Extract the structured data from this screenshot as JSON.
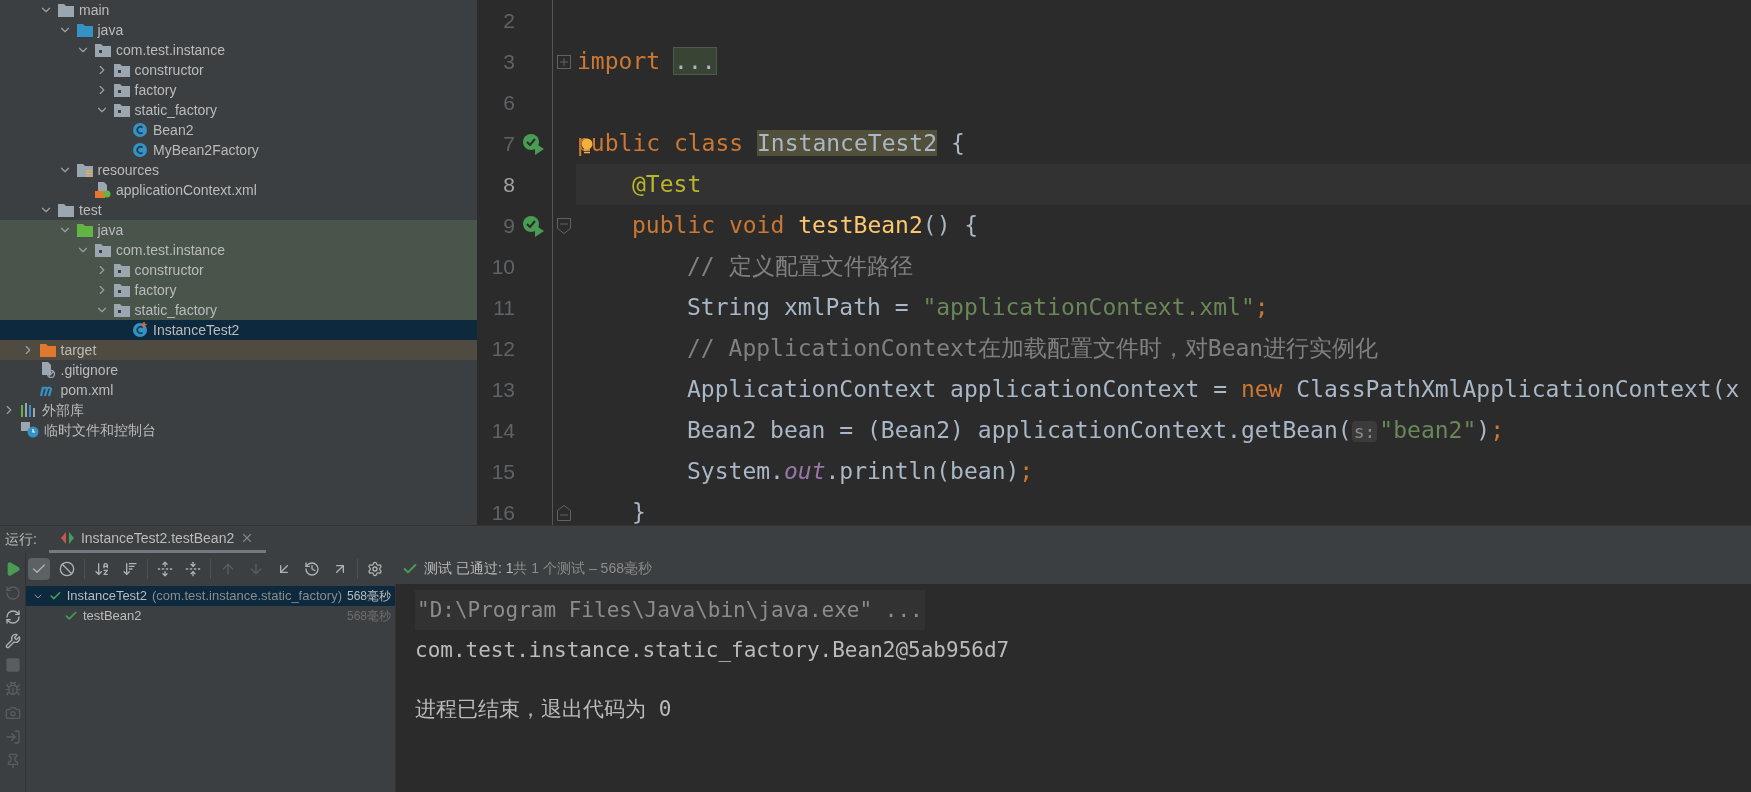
{
  "project_tree": [
    {
      "children": [
        {
          "children": [
            {
              "label": "main",
              "kind": "folder",
              "expanded": true,
              "selected": false,
              "children": [
                {
                  "label": "java",
                  "kind": "source-root",
                  "expanded": true,
                  "selected": false,
                  "children": [
                    {
                      "label": "com.test.instance",
                      "kind": "package",
                      "expanded": true,
                      "selected": false,
                      "children": [
                        {
                          "label": "constructor",
                          "kind": "package",
                          "expanded": false,
                          "selected": false
                        },
                        {
                          "label": "factory",
                          "kind": "package",
                          "expanded": false,
                          "selected": false
                        },
                        {
                          "label": "static_factory",
                          "kind": "package",
                          "expanded": true,
                          "selected": false,
                          "children": [
                            {
                              "label": "Bean2",
                              "kind": "class",
                              "selected": false
                            },
                            {
                              "label": "MyBean2Factory",
                              "kind": "class",
                              "selected": false
                            }
                          ]
                        }
                      ]
                    }
                  ]
                },
                {
                  "label": "resources",
                  "kind": "resources-root",
                  "expanded": true,
                  "selected": false,
                  "children": [
                    {
                      "label": "applicationContext.xml",
                      "kind": "xml",
                      "selected": false
                    }
                  ]
                }
              ]
            },
            {
              "label": "test",
              "kind": "folder",
              "expanded": true,
              "selected": false,
              "children": [
                {
                  "label": "java",
                  "kind": "test-root",
                  "expanded": true,
                  "selected": false,
                  "children": [
                    {
                      "label": "com.test.instance",
                      "kind": "package",
                      "expanded": true,
                      "selected": false,
                      "children": [
                        {
                          "label": "constructor",
                          "kind": "package",
                          "expanded": false,
                          "selected": false
                        },
                        {
                          "label": "factory",
                          "kind": "package",
                          "expanded": false,
                          "selected": false
                        },
                        {
                          "label": "static_factory",
                          "kind": "package",
                          "expanded": true,
                          "selected": false,
                          "children": [
                            {
                              "label": "InstanceTest2",
                              "kind": "test-class",
                              "selected": true
                            }
                          ]
                        }
                      ]
                    }
                  ]
                }
              ]
            }
          ]
        },
        {
          "label": "target",
          "kind": "excluded",
          "expanded": false,
          "selected": false
        },
        {
          "label": ".gitignore",
          "kind": "gitignore",
          "selected": false
        },
        {
          "label": "pom.xml",
          "kind": "maven",
          "selected": false
        }
      ]
    },
    {
      "label": "外部库",
      "kind": "libraries",
      "expanded": false,
      "selected": false
    },
    {
      "label": "临时文件和控制台",
      "kind": "scratches",
      "selected": false
    }
  ],
  "editor": {
    "lines": [
      {
        "number": "2",
        "current": false
      },
      {
        "number": "3",
        "kind": "top",
        "current": false,
        "fold_marker": {
          "kind": "expand"
        },
        "tokens": [
          {
            "kind": "keyword",
            "text": "import"
          },
          {
            "kind": "folded",
            "text": "..."
          }
        ]
      },
      {
        "number": "6",
        "current": false
      },
      {
        "number": "7",
        "kind": "top",
        "current": false,
        "run_marker": true,
        "bulb": true,
        "tokens": [
          {
            "kind": "keyword",
            "text": "public class "
          },
          {
            "kind": "highlight",
            "text": "InstanceTest2"
          },
          {
            "kind": "plain",
            "text": " {"
          }
        ]
      },
      {
        "number": "8",
        "kind": "member",
        "current": true,
        "tokens": [
          {
            "kind": "annotation",
            "text": "@Test"
          }
        ]
      },
      {
        "number": "9",
        "kind": "member",
        "current": false,
        "run_marker": true,
        "fold_marker": {
          "kind": "collapse"
        },
        "tokens": [
          {
            "kind": "keyword",
            "text": "public void "
          },
          {
            "kind": "method",
            "text": "testBean2"
          },
          {
            "kind": "plain",
            "text": "() {"
          }
        ]
      },
      {
        "number": "10",
        "kind": "body",
        "current": false,
        "tokens": [
          {
            "kind": "comment",
            "text": "// 定义配置文件路径"
          }
        ]
      },
      {
        "number": "11",
        "kind": "body",
        "current": false,
        "tokens": [
          {
            "kind": "plain",
            "text": "String xmlPath = "
          },
          {
            "kind": "string",
            "text": "\"applicationContext.xml\""
          },
          {
            "kind": "keyword",
            "text": ";"
          }
        ]
      },
      {
        "number": "12",
        "kind": "body",
        "current": false,
        "tokens": [
          {
            "kind": "comment",
            "text": "// ApplicationContext在加载配置文件时，对Bean进行实例化"
          }
        ]
      },
      {
        "number": "13",
        "kind": "body",
        "current": false,
        "tokens": [
          {
            "kind": "plain",
            "text": "ApplicationContext applicationContext = "
          },
          {
            "kind": "keyword",
            "text": "new"
          },
          {
            "kind": "plain",
            "text": " ClassPathXmlApplicationContext(x"
          }
        ]
      },
      {
        "number": "14",
        "kind": "body",
        "current": false,
        "tokens": [
          {
            "kind": "plain",
            "text": "Bean2 bean = (Bean2) applicationContext.getBean("
          },
          {
            "kind": "hint",
            "text": "s:"
          },
          {
            "kind": "string",
            "text": "\"bean2\""
          },
          {
            "kind": "plain",
            "text": ")"
          },
          {
            "kind": "keyword",
            "text": ";"
          }
        ]
      },
      {
        "number": "15",
        "kind": "body",
        "current": false,
        "tokens": [
          {
            "kind": "plain",
            "text": "System."
          },
          {
            "kind": "field",
            "text": "out"
          },
          {
            "kind": "plain",
            "text": ".println(bean)"
          },
          {
            "kind": "keyword",
            "text": ";"
          }
        ]
      },
      {
        "number": "16",
        "kind": "member",
        "current": false,
        "fold_marker": {
          "kind": "end"
        },
        "tokens": [
          {
            "kind": "plain",
            "text": "}"
          }
        ]
      }
    ]
  },
  "run_panel": {
    "label": "运行:",
    "tabs": [
      {
        "label": "InstanceTest2.testBean2",
        "selected": true
      }
    ],
    "side_toolbar": [
      {
        "kind": "run",
        "disabled": false
      },
      {
        "kind": "rerun-failed",
        "disabled": true
      },
      {
        "kind": "auto-test",
        "disabled": false
      },
      {
        "kind": "wrench",
        "disabled": false
      },
      {
        "kind": "stop",
        "disabled": true
      },
      {
        "kind": "debug",
        "disabled": true
      },
      {
        "kind": "camera",
        "disabled": true
      },
      {
        "kind": "exit",
        "disabled": true
      },
      {
        "kind": "pin",
        "disabled": true
      }
    ],
    "toolbar": [
      {
        "kind": "show-passed",
        "on": true,
        "disabled": false
      },
      {
        "kind": "show-ignored",
        "on": false,
        "disabled": false
      },
      {
        "kind": "sort-alpha",
        "on": false,
        "disabled": false
      },
      {
        "kind": "sort-duration",
        "on": false,
        "disabled": false
      },
      {
        "kind": "expand-all",
        "on": false,
        "disabled": false
      },
      {
        "kind": "collapse-all",
        "on": false,
        "disabled": false
      },
      {
        "kind": "previous",
        "on": false,
        "disabled": true
      },
      {
        "kind": "next",
        "on": false,
        "disabled": true
      },
      {
        "kind": "import",
        "on": false,
        "disabled": false
      },
      {
        "kind": "history",
        "on": false,
        "disabled": false
      },
      {
        "kind": "export",
        "on": false,
        "disabled": false
      },
      {
        "kind": "settings",
        "on": false,
        "disabled": false
      }
    ],
    "status": {
      "passed": "测试 已通过: 1",
      "summary": "共 1 个测试 – 568毫秒"
    },
    "results": [
      {
        "name": "InstanceTest2",
        "detail": "(com.test.instance.static_factory)",
        "duration": "568毫秒",
        "selected": true,
        "expanded": true,
        "children": [
          {
            "name": "testBean2",
            "duration": "568毫秒",
            "selected": false
          }
        ]
      }
    ],
    "console": [
      {
        "kind": "command",
        "text": "\"D:\\Program Files\\Java\\bin\\java.exe\" ..."
      },
      {
        "kind": "output",
        "text": "com.test.instance.static_factory.Bean2@5ab956d7"
      },
      {
        "kind": "exit",
        "text": "进程已结束，退出代码为 0"
      }
    ]
  }
}
